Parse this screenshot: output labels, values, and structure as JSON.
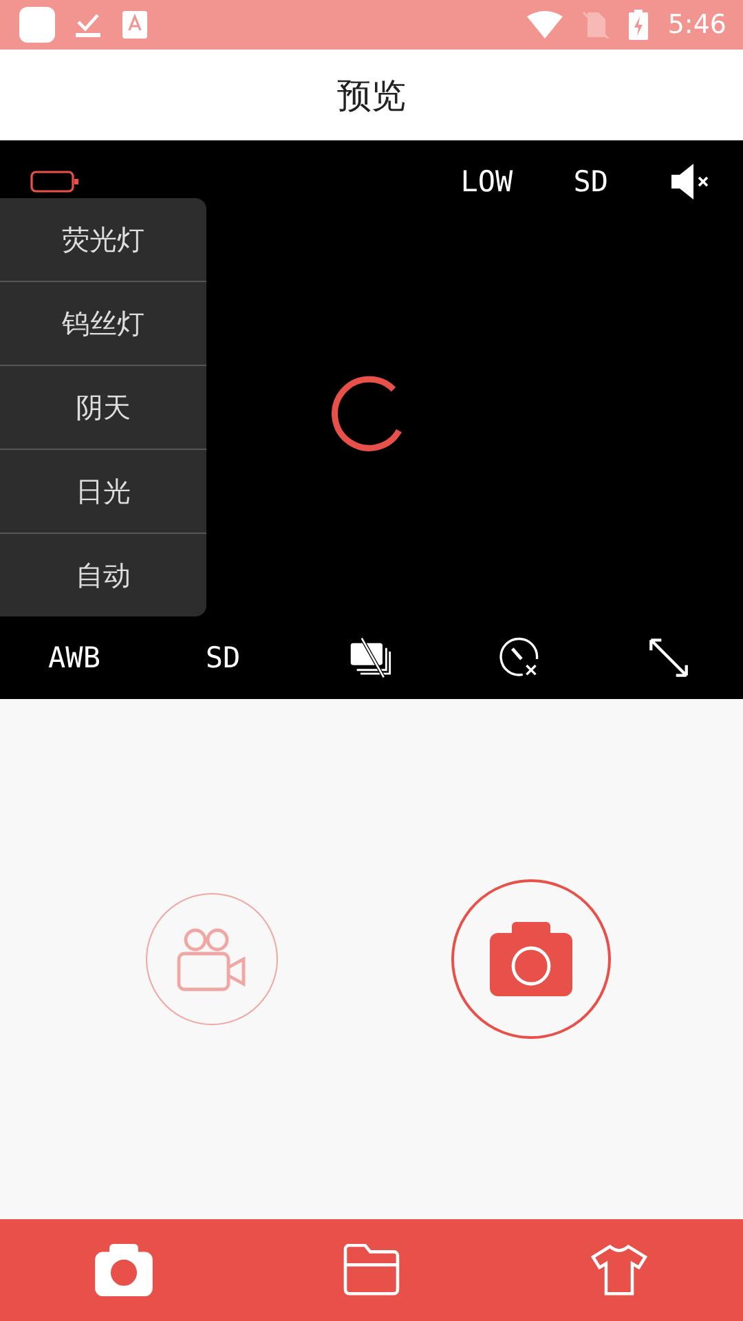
{
  "status_bar": {
    "time": "5:46"
  },
  "title": "预览",
  "preview": {
    "loading": true,
    "top_bar": [
      {
        "kind": "battery"
      },
      {
        "kind": "text",
        "label": "LOW"
      },
      {
        "kind": "text",
        "label": "SD"
      },
      {
        "kind": "mute"
      }
    ],
    "white_balance_menu": [
      {
        "label": "荧光灯"
      },
      {
        "label": "钨丝灯"
      },
      {
        "label": "阴天"
      },
      {
        "label": "日光"
      },
      {
        "label": "自动"
      }
    ],
    "toolbar": [
      {
        "kind": "text",
        "label": "AWB"
      },
      {
        "kind": "text",
        "label": "SD"
      },
      {
        "kind": "burst-off"
      },
      {
        "kind": "timer-off"
      },
      {
        "kind": "fullscreen"
      }
    ]
  },
  "capture_buttons": [
    {
      "kind": "video",
      "selected": false
    },
    {
      "kind": "photo",
      "selected": true
    }
  ],
  "nav": [
    {
      "kind": "camera",
      "selected": true
    },
    {
      "kind": "folder",
      "selected": false
    },
    {
      "kind": "shirt",
      "selected": false
    }
  ]
}
